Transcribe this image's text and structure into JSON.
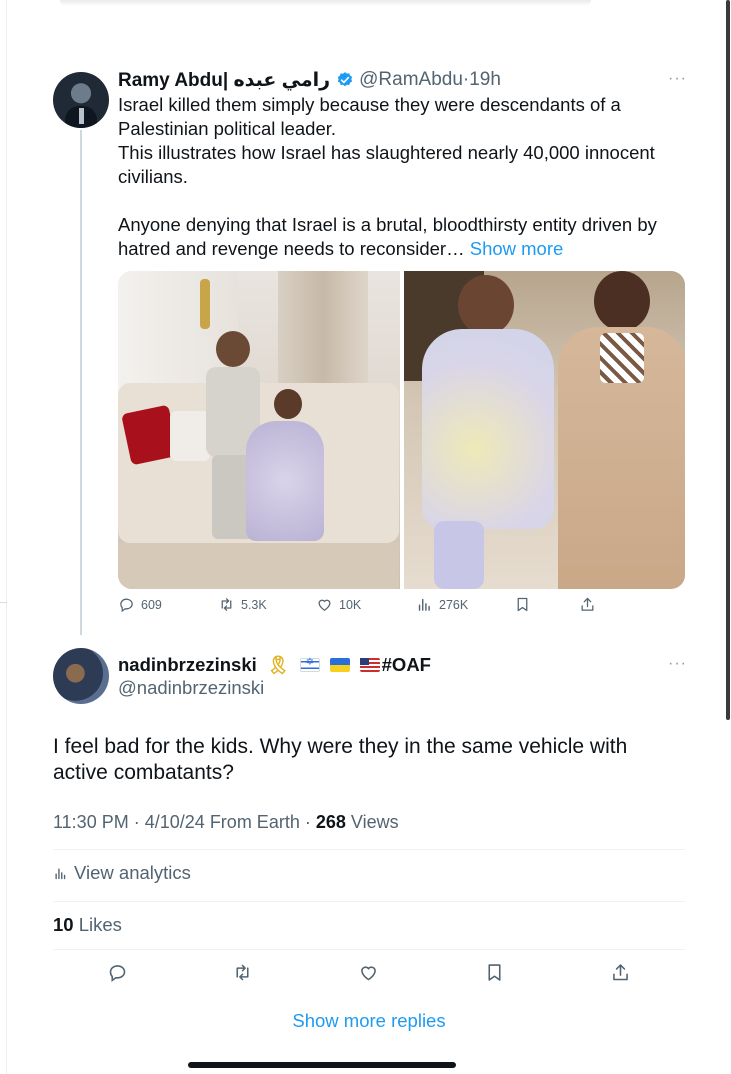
{
  "quoted_tweet": {
    "display_name": "Ramy Abdu| رامي عبده",
    "handle": "@RamAbdu",
    "separator": "·",
    "time": "19h",
    "more": "···",
    "body_lines": [
      "Israel killed them simply because they were descendants of a Palestinian political leader.",
      "This illustrates how Israel has slaughtered nearly 40,000 innocent civilians."
    ],
    "body_paragraph2": "Anyone denying that Israel is a brutal, bloodthirsty entity driven by hatred and revenge needs to reconsider…",
    "show_more": "Show more",
    "stats": {
      "replies": "609",
      "reposts": "5.3K",
      "likes": "10K",
      "views": "276K"
    }
  },
  "reply_tweet": {
    "display_name": "nadinbrzezinski",
    "name_suffix": "#OAF",
    "handle": "@nadinbrzezinski",
    "more": "···",
    "body": "I feel bad for the kids. Why were they in the same vehicle with active combatants?",
    "time": "11:30 PM",
    "date": "4/10/24",
    "source": "From Earth",
    "views_count": "268",
    "views_label": "Views",
    "analytics_label": "View analytics",
    "likes_count": "10",
    "likes_label": "Likes"
  },
  "show_more_replies": "Show more replies",
  "colors": {
    "accent": "#1d9bf0",
    "secondary_text": "#536471",
    "primary_text": "#0f1419"
  },
  "icons": [
    "verified-badge-icon",
    "reply-icon",
    "repost-icon",
    "like-icon",
    "views-icon",
    "bookmark-icon",
    "share-icon",
    "analytics-icon",
    "ribbon-icon",
    "israel-flag-icon",
    "ukraine-flag-icon",
    "us-flag-icon"
  ]
}
